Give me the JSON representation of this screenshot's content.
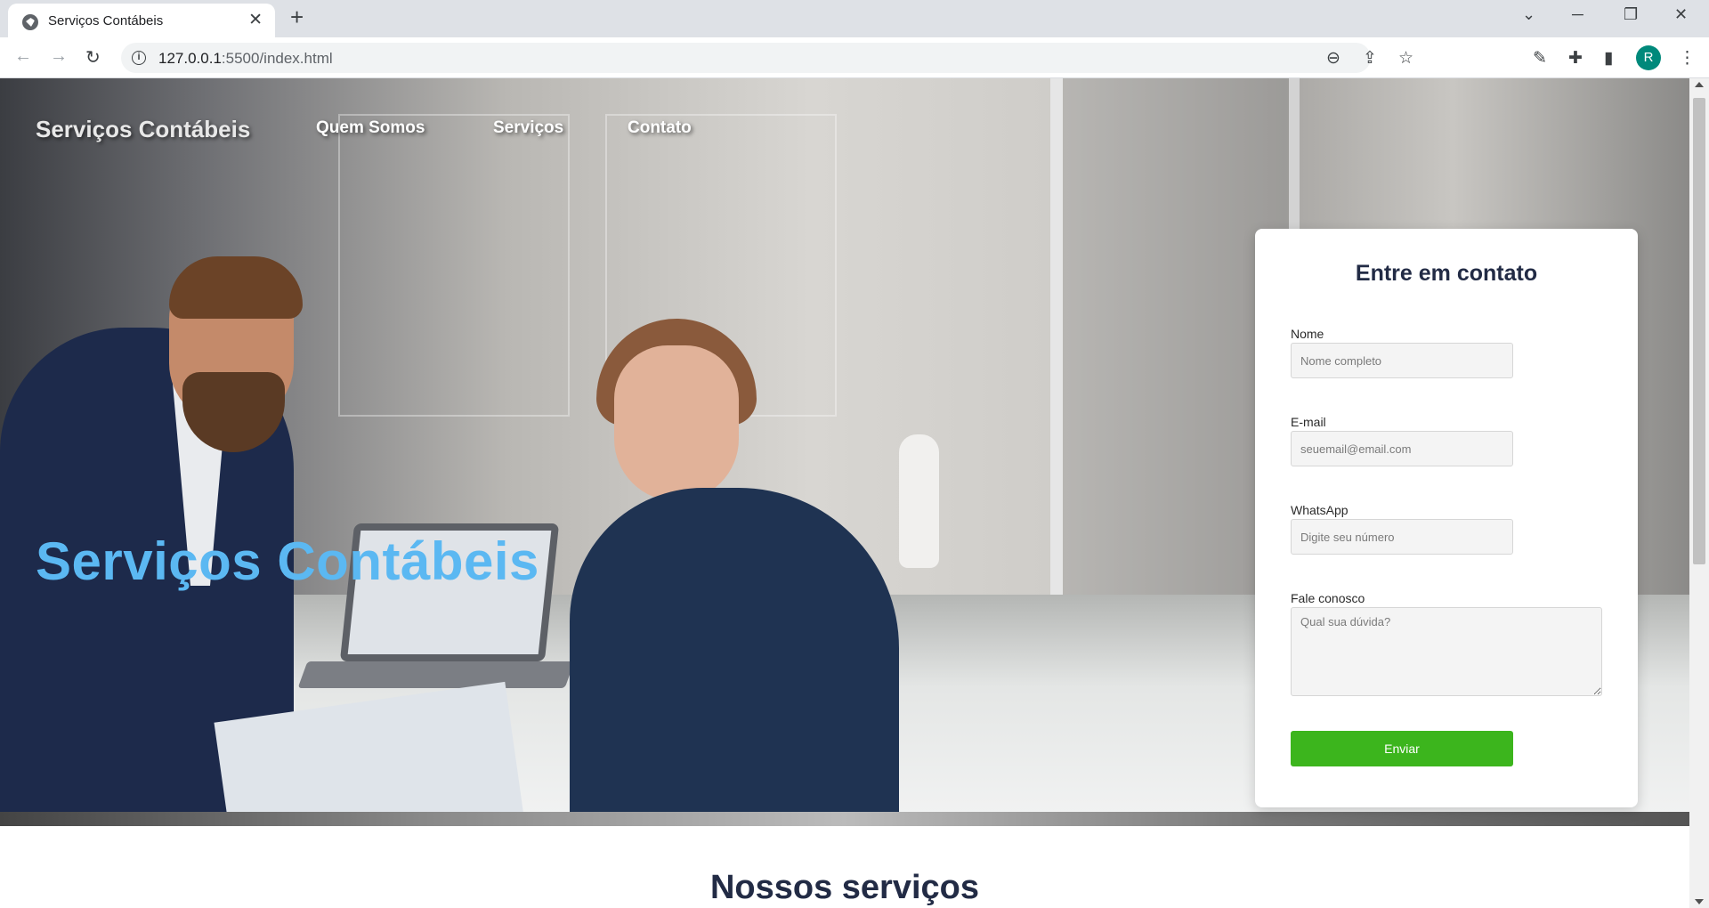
{
  "browser": {
    "tab_title": "Serviços Contábeis",
    "tab_close": "✕",
    "new_tab": "+",
    "url_host": "127.0.0.1",
    "url_rest": ":5500/index.html",
    "avatar_initial": "R",
    "window_controls": {
      "minimize": "─",
      "restore": "❐",
      "close": "✕",
      "tabsearch": "⌄"
    }
  },
  "site": {
    "brand": "Serviços Contábeis",
    "nav": [
      "Quem Somos",
      "Serviços",
      "Contato"
    ],
    "hero_title": "Serviços Contábeis",
    "accent_color": "#5bb8f2"
  },
  "contact_form": {
    "title": "Entre em contato",
    "name_label": "Nome",
    "name_placeholder": "Nome completo",
    "email_label": "E-mail",
    "email_placeholder": "seuemail@email.com",
    "whatsapp_label": "WhatsApp",
    "whatsapp_placeholder": "Digite seu número",
    "message_label": "Fale conosco",
    "message_placeholder": "Qual sua dúvida?",
    "submit_label": "Enviar",
    "submit_color": "#3cb51d"
  },
  "services_section": {
    "title": "Nossos serviços"
  }
}
